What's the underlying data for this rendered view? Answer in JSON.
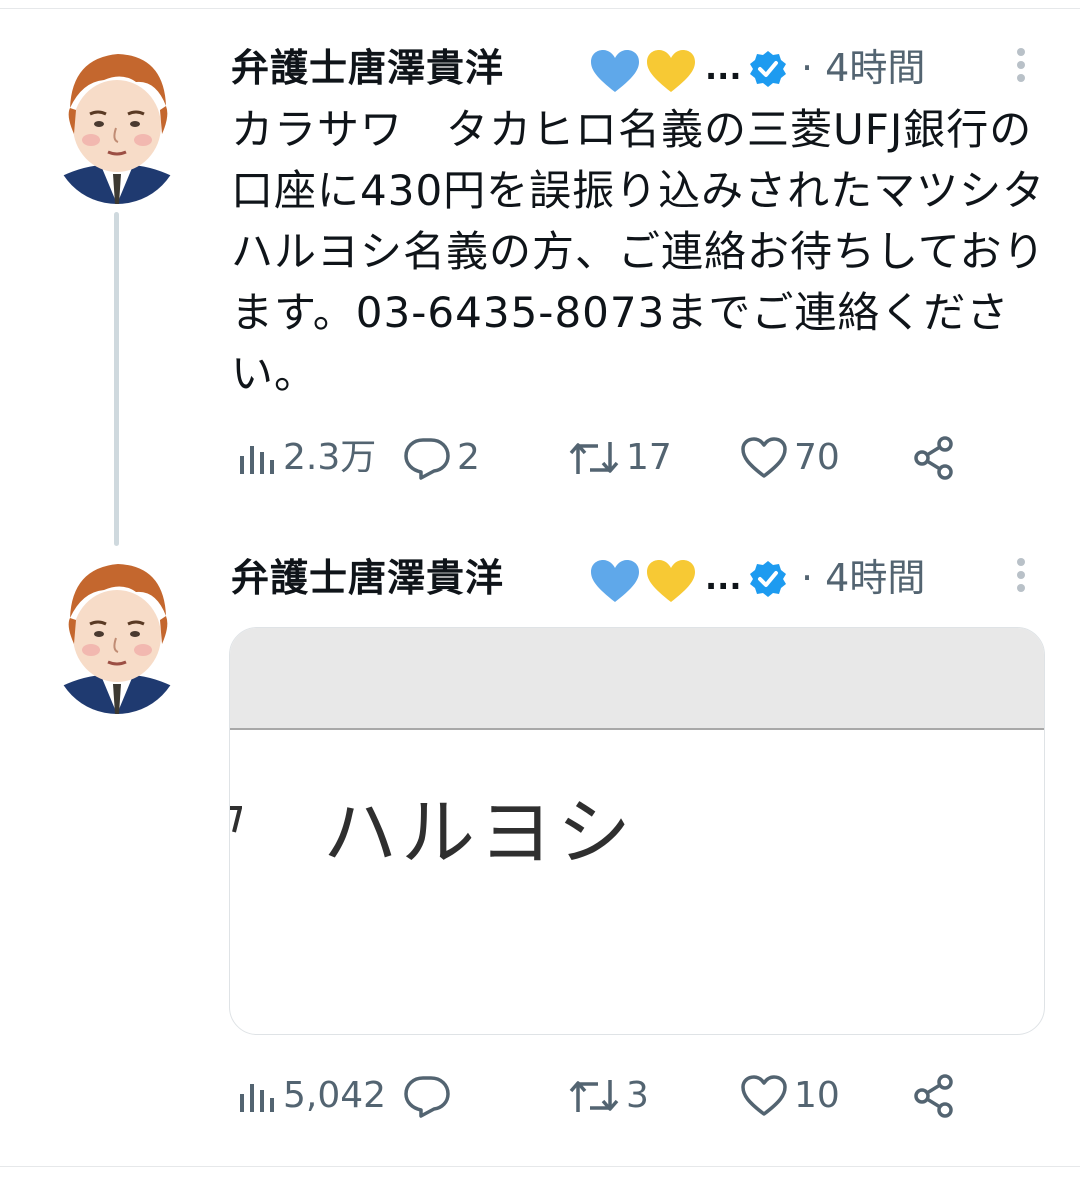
{
  "tweets": [
    {
      "author": "弁護士唐澤貴洋",
      "hearts_overflow": "...",
      "time": "· 4時間",
      "text": "カラサワ　タカヒロ名義の三菱UFJ銀行の口座に430円を誤振り込みされたマツシタハルヨシ名義の方、ご連絡お待ちしております。03-6435-8073までご連絡ください。",
      "stats": {
        "views": "2.3万",
        "replies": "2",
        "reposts": "17",
        "likes": "70"
      }
    },
    {
      "author": "弁護士唐澤貴洋",
      "hearts_overflow": "...",
      "time": "· 4時間",
      "media_text": "ハルヨシ",
      "stats": {
        "views": "5,042",
        "replies": "",
        "reposts": "3",
        "likes": "10"
      }
    }
  ],
  "colors": {
    "heart_blue": "#5fa8ea",
    "heart_yellow": "#f7c934",
    "verified": "#1d9bf0",
    "secondary_text": "#536471"
  },
  "icons": [
    "verified-badge-icon",
    "more-icon",
    "views-icon",
    "reply-icon",
    "repost-icon",
    "like-icon",
    "share-icon"
  ]
}
